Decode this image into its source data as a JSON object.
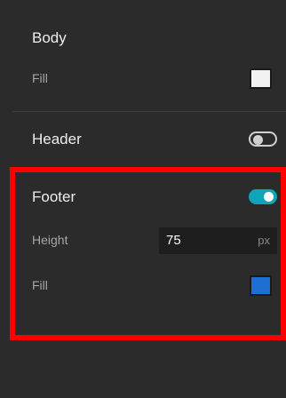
{
  "body_section": {
    "title": "Body",
    "fill_label": "Fill",
    "fill_color": "#f2f2f2"
  },
  "header_section": {
    "title": "Header",
    "enabled": false
  },
  "footer_section": {
    "title": "Footer",
    "enabled": true,
    "height_label": "Height",
    "height_value": "75",
    "height_unit": "px",
    "fill_label": "Fill",
    "fill_color": "#1d6fd1"
  },
  "colors": {
    "panel_bg": "#2b2b2b",
    "toggle_on": "#0fa4b8",
    "highlight": "#ff0000"
  }
}
